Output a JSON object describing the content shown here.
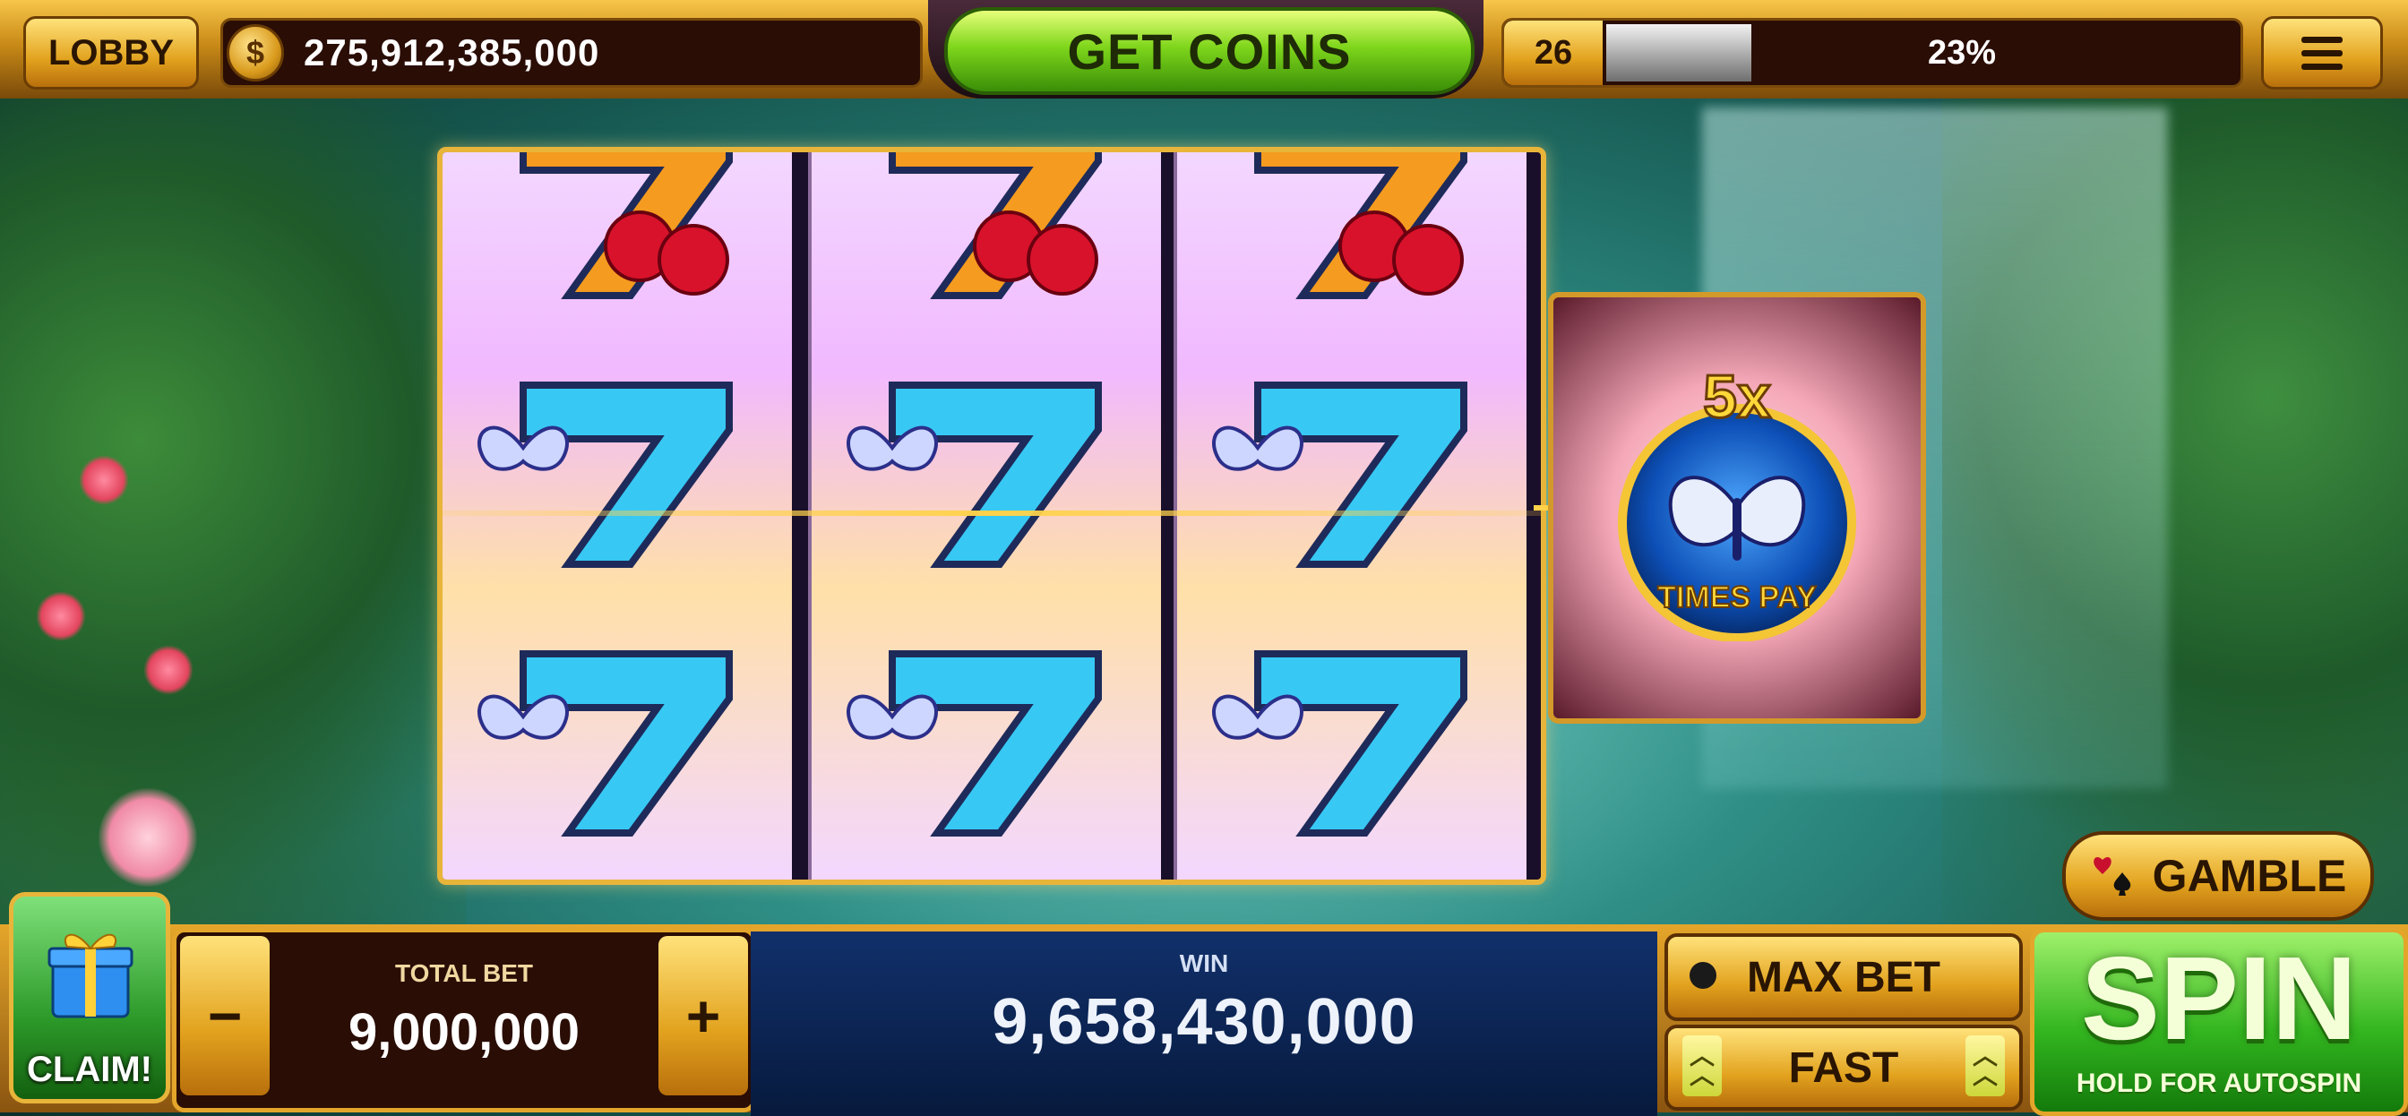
{
  "header": {
    "lobby_label": "LOBBY",
    "coin_symbol": "$",
    "coin_balance": "275,912,385,000",
    "get_coins_label": "GET COINS",
    "level": "26",
    "level_progress_text": "23%",
    "level_progress_fraction": 0.23
  },
  "reels": {
    "columns": [
      [
        "seven-cherry-orange",
        "seven-butterfly-blue",
        "seven-butterfly-blue"
      ],
      [
        "seven-cherry-orange",
        "seven-butterfly-blue",
        "seven-butterfly-blue"
      ],
      [
        "seven-cherry-orange",
        "seven-butterfly-blue",
        "seven-butterfly-blue"
      ]
    ],
    "bonus_reel": {
      "multiplier": "5x",
      "caption": "TIMES PAY"
    }
  },
  "gamble_label": "GAMBLE",
  "claim_label": "CLAIM!",
  "bet": {
    "label": "TOTAL BET",
    "value": "9,000,000",
    "minus": "−",
    "plus": "+"
  },
  "win": {
    "label": "WIN",
    "value": "9,658,430,000"
  },
  "max_bet_label": "MAX BET",
  "fast_label": "FAST",
  "spin": {
    "label": "SPIN",
    "sub_label": "HOLD FOR AUTOSPIN"
  },
  "colors": {
    "gold": "#e2a21e",
    "green": "#33b61f",
    "navy": "#0b2451"
  }
}
